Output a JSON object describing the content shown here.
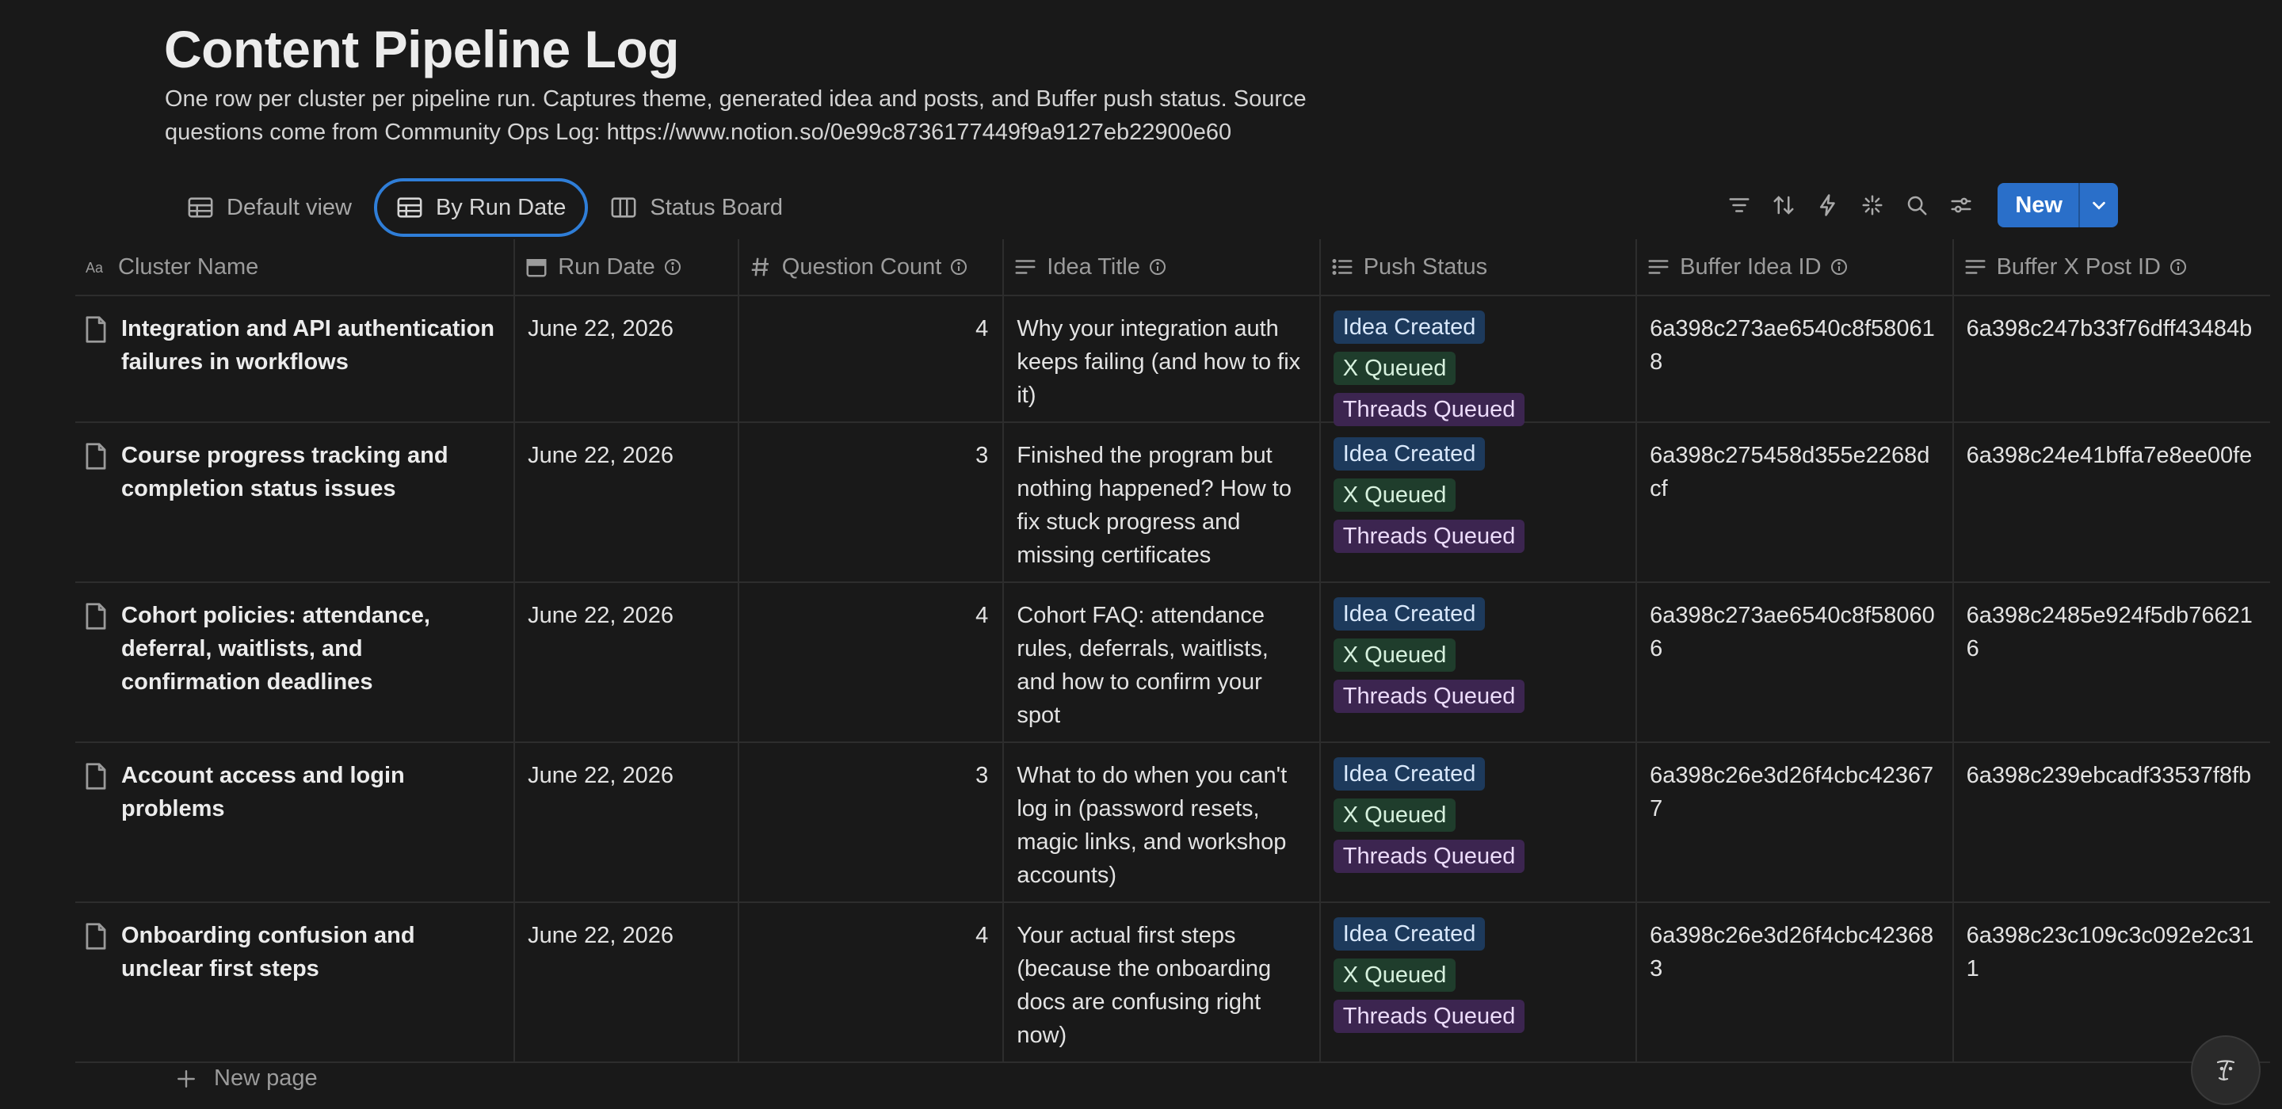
{
  "page": {
    "title": "Content Pipeline Log",
    "description_line1": "One row per cluster per pipeline run. Captures theme, generated idea and posts, and Buffer push status. Source",
    "description_line2": "questions come from Community Ops Log: https://www.notion.so/0e99c8736177449f9a9127eb22900e60"
  },
  "views": [
    {
      "label": "Default view",
      "icon": "table-icon",
      "active": false
    },
    {
      "label": "By Run Date",
      "icon": "table-icon",
      "active": true
    },
    {
      "label": "Status Board",
      "icon": "board-icon",
      "active": false
    }
  ],
  "toolbar": {
    "new_label": "New",
    "icons": [
      "filter-icon",
      "sort-icon",
      "automation-icon",
      "ai-sparkle-icon",
      "search-icon",
      "settings-icon"
    ]
  },
  "columns": [
    {
      "label": "Cluster Name",
      "icon": "title-icon",
      "info": false
    },
    {
      "label": "Run Date",
      "icon": "calendar-icon",
      "info": true
    },
    {
      "label": "Question Count",
      "icon": "number-icon",
      "info": true
    },
    {
      "label": "Idea Title",
      "icon": "text-icon",
      "info": true
    },
    {
      "label": "Push Status",
      "icon": "multiselect-icon",
      "info": false
    },
    {
      "label": "Buffer Idea ID",
      "icon": "text-icon",
      "info": true
    },
    {
      "label": "Buffer X Post ID",
      "icon": "text-icon",
      "info": true
    }
  ],
  "rows": [
    {
      "cluster": "Integration and API authentication failures in workflows",
      "run_date": "June 22, 2026",
      "question_count": "4",
      "idea_title": "Why your integration auth keeps failing (and how to fix it)",
      "tags": [
        "Idea Created",
        "X Queued",
        "Threads Queued"
      ],
      "buffer_idea_id": "6a398c273ae6540c8f580618",
      "buffer_x_post_id": "6a398c247b33f76dff43484b"
    },
    {
      "cluster": "Course progress tracking and completion status issues",
      "run_date": "June 22, 2026",
      "question_count": "3",
      "idea_title": "Finished the program but nothing happened? How to fix stuck progress and missing certificates",
      "tags": [
        "Idea Created",
        "X Queued",
        "Threads Queued"
      ],
      "buffer_idea_id": "6a398c275458d355e2268dcf",
      "buffer_x_post_id": "6a398c24e41bffa7e8ee00fe"
    },
    {
      "cluster": "Cohort policies: attendance, deferral, waitlists, and confirmation deadlines",
      "run_date": "June 22, 2026",
      "question_count": "4",
      "idea_title": "Cohort FAQ: attendance rules, deferrals, waitlists, and how to confirm your spot",
      "tags": [
        "Idea Created",
        "X Queued",
        "Threads Queued"
      ],
      "buffer_idea_id": "6a398c273ae6540c8f580606",
      "buffer_x_post_id": "6a398c2485e924f5db766216"
    },
    {
      "cluster": "Account access and login problems",
      "run_date": "June 22, 2026",
      "question_count": "3",
      "idea_title": "What to do when you can't log in (password resets, magic links, and workshop accounts)",
      "tags": [
        "Idea Created",
        "X Queued",
        "Threads Queued"
      ],
      "buffer_idea_id": "6a398c26e3d26f4cbc423677",
      "buffer_x_post_id": "6a398c239ebcadf33537f8fb"
    },
    {
      "cluster": "Onboarding confusion and unclear first steps",
      "run_date": "June 22, 2026",
      "question_count": "4",
      "idea_title": "Your actual first steps (because the onboarding docs are confusing right now)",
      "tags": [
        "Idea Created",
        "X Queued",
        "Threads Queued"
      ],
      "buffer_idea_id": "6a398c26e3d26f4cbc423683",
      "buffer_x_post_id": "6a398c23c109c3c092e2c311"
    }
  ],
  "footer": {
    "new_page_label": "New page"
  },
  "colors": {
    "background": "#191919",
    "accent": "#2a6fc9",
    "tag_idea_created": "#1d3a5c",
    "tag_x_queued": "#1f3d2c",
    "tag_threads_queued": "#3c2550"
  }
}
